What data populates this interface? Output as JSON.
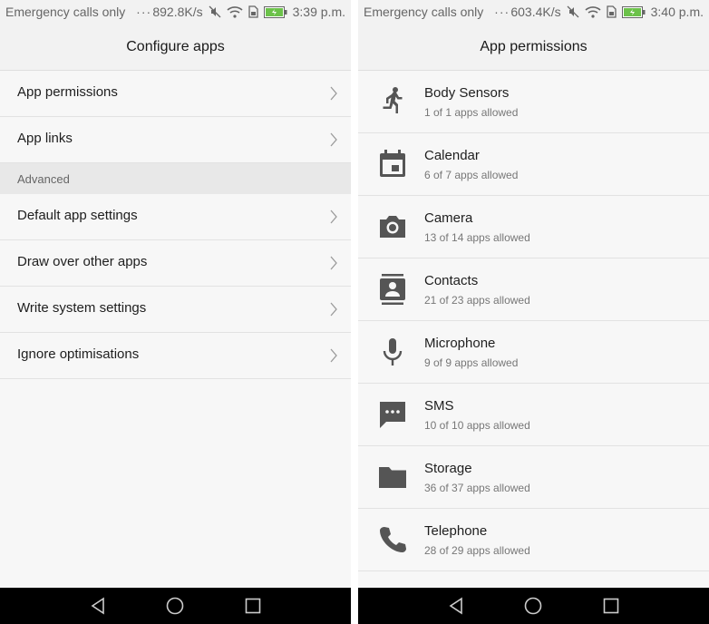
{
  "left_screen": {
    "status": {
      "carrier": "Emergency calls only",
      "dots": "···",
      "speed": "892.8K/s",
      "time": "3:39 p.m."
    },
    "title": "Configure apps",
    "items": [
      {
        "label": "App permissions"
      },
      {
        "label": "App links"
      }
    ],
    "section_label": "Advanced",
    "advanced_items": [
      {
        "label": "Default app settings"
      },
      {
        "label": "Draw over other apps"
      },
      {
        "label": "Write system settings"
      },
      {
        "label": "Ignore optimisations"
      }
    ]
  },
  "right_screen": {
    "status": {
      "carrier": "Emergency calls only",
      "dots": "···",
      "speed": "603.4K/s",
      "time": "3:40 p.m."
    },
    "title": "App permissions",
    "permissions": [
      {
        "title": "Body Sensors",
        "subtitle": "1 of 1 apps allowed",
        "icon": "runner-icon"
      },
      {
        "title": "Calendar",
        "subtitle": "6 of 7 apps allowed",
        "icon": "calendar-icon"
      },
      {
        "title": "Camera",
        "subtitle": "13 of 14 apps allowed",
        "icon": "camera-icon"
      },
      {
        "title": "Contacts",
        "subtitle": "21 of 23 apps allowed",
        "icon": "contacts-icon"
      },
      {
        "title": "Microphone",
        "subtitle": "9 of 9 apps allowed",
        "icon": "microphone-icon"
      },
      {
        "title": "SMS",
        "subtitle": "10 of 10 apps allowed",
        "icon": "sms-icon"
      },
      {
        "title": "Storage",
        "subtitle": "36 of 37 apps allowed",
        "icon": "folder-icon"
      },
      {
        "title": "Telephone",
        "subtitle": "28 of 29 apps allowed",
        "icon": "phone-icon"
      }
    ]
  },
  "colors": {
    "icon": "#555555",
    "battery": "#6cc24a",
    "navbar": "#000000"
  }
}
